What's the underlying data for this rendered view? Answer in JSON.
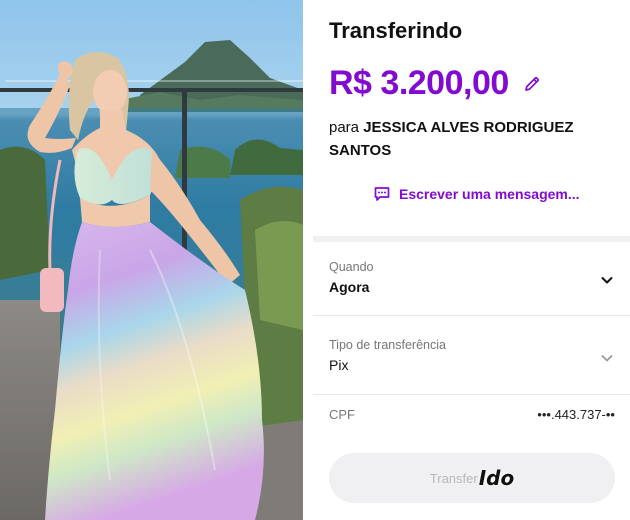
{
  "transfer": {
    "title": "Transferindo",
    "amount": "R$ 3.200,00",
    "recipient_prefix": "para",
    "recipient_name": "JESSICA ALVES RODRIGUEZ SANTOS",
    "message_link": "Escrever uma mensagem...",
    "when_label": "Quando",
    "when_value": "Agora",
    "type_label": "Tipo de transferência",
    "type_value": "Pix",
    "cpf_label": "CPF",
    "cpf_value": "•••.443.737-••",
    "button_label": "Transfer",
    "button_overlay": "Ido"
  },
  "icons": {
    "edit": "pencil-icon",
    "message": "message-icon",
    "dropdown": "chevron-down-icon"
  },
  "colors": {
    "accent": "#820ad1",
    "text": "#111111",
    "muted": "#777777",
    "button_bg": "#f0f0f2",
    "button_text": "#b8b8b8"
  }
}
